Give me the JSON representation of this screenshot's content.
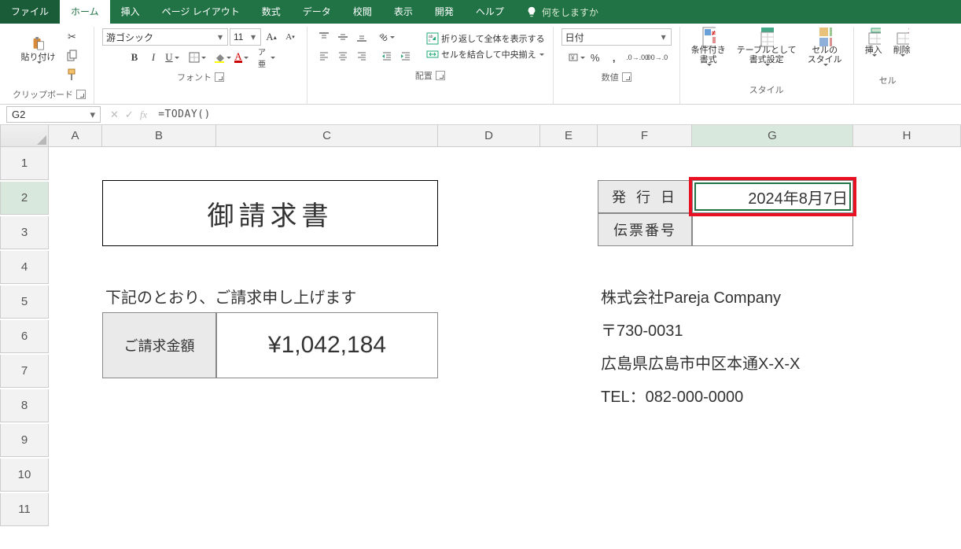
{
  "tabs": {
    "file": "ファイル",
    "home": "ホーム",
    "insert": "挿入",
    "page_layout": "ページ レイアウト",
    "formulas": "数式",
    "data": "データ",
    "review": "校閲",
    "view": "表示",
    "developer": "開発",
    "help": "ヘルプ",
    "tellme": "何をしますか"
  },
  "ribbon": {
    "clipboard": {
      "paste": "貼り付け",
      "label": "クリップボード"
    },
    "font": {
      "name": "游ゴシック",
      "size": "11",
      "label": "フォント",
      "bold": "B",
      "italic": "I",
      "underline": "U"
    },
    "alignment": {
      "label": "配置",
      "wrap": "折り返して全体を表示する",
      "merge": "セルを結合して中央揃え"
    },
    "number": {
      "format": "日付",
      "label": "数値"
    },
    "styles": {
      "cond": "条件付き\n書式",
      "table": "テーブルとして\n書式設定",
      "cell": "セルの\nスタイル",
      "label": "スタイル"
    },
    "cells": {
      "insert": "挿入",
      "delete": "削除",
      "label": "セル"
    }
  },
  "fxbar": {
    "name": "G2",
    "formula": "=TODAY()"
  },
  "columns": [
    "A",
    "B",
    "C",
    "D",
    "E",
    "F",
    "G",
    "H"
  ],
  "rows": [
    "1",
    "2",
    "3",
    "4",
    "5",
    "6",
    "7",
    "8",
    "9",
    "10",
    "11"
  ],
  "sheet": {
    "title": "御請求書",
    "issue_date_label": "発 行 日",
    "issue_date_value": "2024年8月7日",
    "slip_label": "伝票番号",
    "intro": "下記のとおり、ご請求申し上げます",
    "amount_label": "ご請求金額",
    "amount_value": "¥1,042,184",
    "company": "株式会社Pareja Company",
    "postal": "〒730-0031",
    "address": "広島県広島市中区本通X-X-X",
    "tel": "TEL：082-000-0000"
  }
}
